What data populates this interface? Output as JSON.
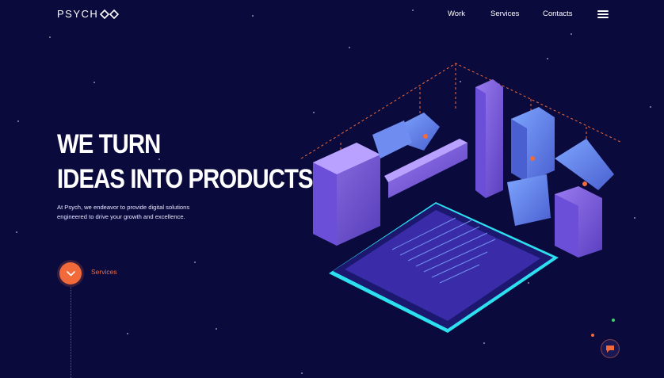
{
  "brand": {
    "name": "PSYCH",
    "logo_icon": "infinity-icon"
  },
  "nav": {
    "items": [
      {
        "label": "Work"
      },
      {
        "label": "Services"
      },
      {
        "label": "Contacts"
      }
    ],
    "menu_icon": "hamburger-menu-icon"
  },
  "hero": {
    "title_line1": "WE TURN",
    "title_line2": "IDEAS INTO PRODUCTS.",
    "description_line1": "At Psych, we endeavor to provide digital solutions",
    "description_line2": "engineered to drive your growth and excellence."
  },
  "cta": {
    "label": "Services",
    "icon": "chevron-down-icon"
  },
  "chat": {
    "icon": "chat-bubble-icon"
  },
  "colors": {
    "background": "#0b0a3d",
    "accent": "#f26a3a",
    "glow": "#2de0f0",
    "purple": "#6b4fd8"
  }
}
